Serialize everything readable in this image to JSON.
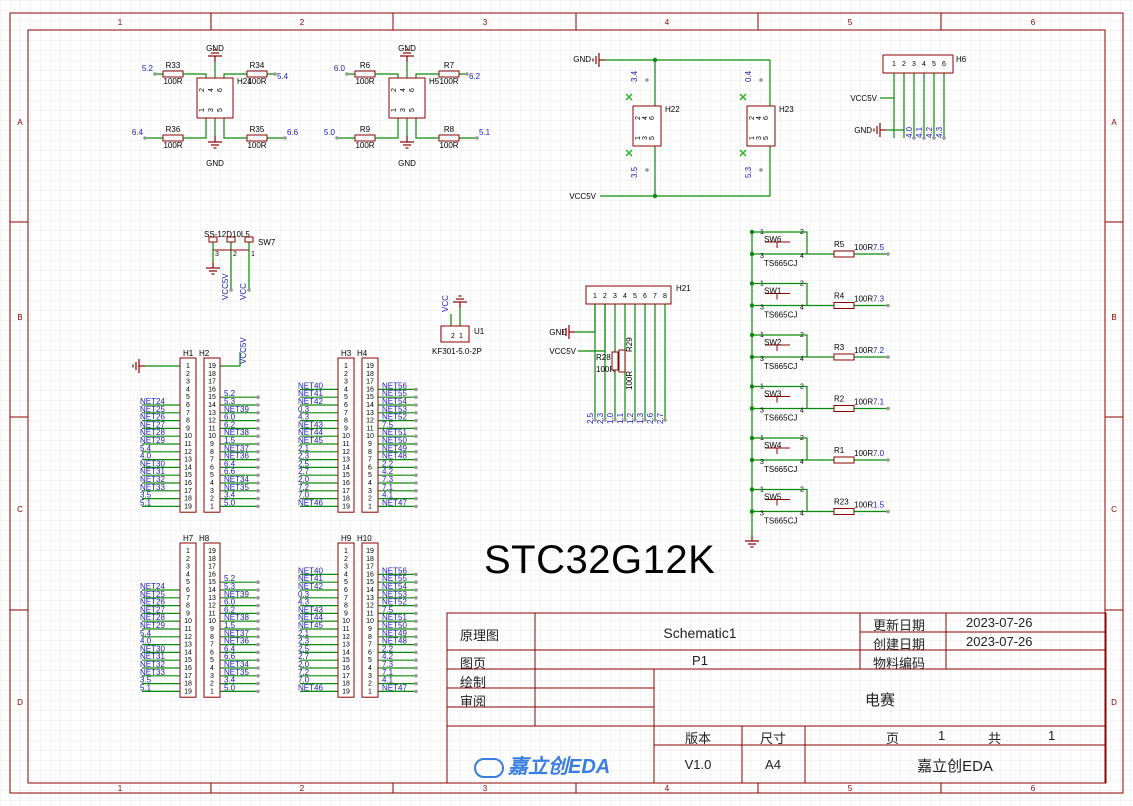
{
  "title": "STC32G12K",
  "border": {
    "columns": [
      "1",
      "2",
      "3",
      "4",
      "5",
      "6"
    ],
    "rows": [
      "A",
      "B",
      "C",
      "D"
    ]
  },
  "title_block": {
    "schematic_label": "原理图",
    "schematic_value": "Schematic1",
    "page_label": "图页",
    "page_value": "P1",
    "drawn_label": "绘制",
    "review_label": "审阅",
    "updated_label": "更新日期",
    "updated_value": "2023-07-26",
    "created_label": "创建日期",
    "created_value": "2023-07-26",
    "material_label": "物料编码",
    "project_name": "电赛",
    "version_label": "版本",
    "version_value": "V1.0",
    "size_label": "尺寸",
    "size_value": "A4",
    "pages_label": "页",
    "page_num": "1",
    "total_label": "共",
    "total_num": "1",
    "company": "嘉立创EDA",
    "logo": "嘉立创EDA"
  },
  "components": {
    "h24": {
      "ref": "H24",
      "r_tl": "R33",
      "r_tr": "R34",
      "r_bl": "R36",
      "r_br": "R35",
      "val": "100R",
      "n_tl": "5.2",
      "n_tr": "5.4",
      "n_bl": "6.4",
      "n_br": "6.6"
    },
    "h5": {
      "ref": "H5",
      "r_tl": "R6",
      "r_tr": "R7",
      "r_bl": "R9",
      "r_br": "R8",
      "val": "100R",
      "n_tl": "6.0",
      "n_tr": "6.2",
      "n_bl": "5.0",
      "n_br": "5.1"
    },
    "gnd": "GND",
    "vcc5v": "VCC5V",
    "vcc": "VCC",
    "h22": {
      "ref": "H22",
      "n_top": "3.4",
      "n_bot": "3.5"
    },
    "h23": {
      "ref": "H23",
      "n_top": "0.4",
      "n_bot": "5.3"
    },
    "h6": {
      "ref": "H6",
      "pins": [
        "1",
        "2",
        "3",
        "4",
        "5",
        "6"
      ],
      "nets": [
        "4.0",
        "4.1",
        "4.2",
        "4.3"
      ]
    },
    "sw7": {
      "ref": "SW7",
      "part": "SS-12D10L5",
      "pins": [
        "3",
        "2",
        "1"
      ]
    },
    "u1": {
      "ref": "U1",
      "part": "KF301-5.0-2P",
      "pins": [
        "2",
        "1"
      ]
    },
    "h21": {
      "ref": "H21",
      "pins": [
        "1",
        "2",
        "3",
        "4",
        "5",
        "6",
        "7",
        "8"
      ],
      "nets": [
        "2.5",
        "2.3",
        "1.0",
        "1.1",
        "1.2",
        "1.3",
        "2.6",
        "2.7"
      ],
      "r_ref": "R28",
      "r_val": "100R",
      "r2_ref": "R29",
      "r2_val": "100R"
    },
    "switches": [
      {
        "ref": "SW6",
        "part": "TS665CJ",
        "r": "R5",
        "val": "100R",
        "net": "7.5"
      },
      {
        "ref": "SW1",
        "part": "TS665CJ",
        "r": "R4",
        "val": "100R",
        "net": "7.3"
      },
      {
        "ref": "SW2",
        "part": "TS665CJ",
        "r": "R3",
        "val": "100R",
        "net": "7.2"
      },
      {
        "ref": "SW3",
        "part": "TS665CJ",
        "r": "R2",
        "val": "100R",
        "net": "7.1"
      },
      {
        "ref": "SW4",
        "part": "TS665CJ",
        "r": "R1",
        "val": "100R",
        "net": "7.0"
      },
      {
        "ref": "SW5",
        "part": "TS665CJ",
        "r": "R23",
        "val": "100R",
        "net": "1.5"
      }
    ],
    "header_pairs": [
      {
        "a": "H1",
        "b": "H2",
        "left": [
          "NET24",
          "NET25",
          "NET26",
          "NET27",
          "NET28",
          "NET29",
          "5.4",
          "4.0",
          "NET30",
          "NET31",
          "NET32",
          "NET33",
          "3.5",
          "5.1"
        ],
        "right": [
          "5.2",
          "5.3",
          "NET39",
          "6.0",
          "6.2",
          "NET38",
          "1.5",
          "NET37",
          "NET36",
          "6.4",
          "6.6",
          "NET34",
          "NET35",
          "3.4",
          "5.0"
        ]
      },
      {
        "a": "H3",
        "b": "H4",
        "left": [
          "NET40",
          "NET41",
          "NET42",
          "0.3",
          "4.3",
          "NET43",
          "NET44",
          "NET45",
          "2.1",
          "2.3",
          "2.5",
          "2.7",
          "2.0",
          "7.2",
          "7.0",
          "NET46"
        ],
        "right": [
          "NET56",
          "NET55",
          "NET54",
          "NET53",
          "NET52",
          "7.5",
          "NET51",
          "NET50",
          "NET49",
          "NET48",
          "2.2",
          "4.2",
          "7.3",
          "7.1",
          "4.1",
          "NET47"
        ]
      },
      {
        "a": "H7",
        "b": "H8",
        "left": [
          "NET24",
          "NET25",
          "NET26",
          "NET27",
          "NET28",
          "NET29",
          "5.4",
          "4.0",
          "NET30",
          "NET31",
          "NET32",
          "NET33",
          "3.5",
          "5.1"
        ],
        "right": [
          "5.2",
          "5.3",
          "NET39",
          "6.0",
          "6.2",
          "NET38",
          "1.5",
          "NET37",
          "NET36",
          "6.4",
          "6.6",
          "NET34",
          "NET35",
          "3.4",
          "5.0"
        ]
      },
      {
        "a": "H9",
        "b": "H10",
        "left": [
          "NET40",
          "NET41",
          "NET42",
          "0.3",
          "4.3",
          "NET43",
          "NET44",
          "NET45",
          "2.1",
          "2.3",
          "2.5",
          "2.7",
          "2.0",
          "7.2",
          "7.0",
          "NET46"
        ],
        "right": [
          "NET56",
          "NET55",
          "NET54",
          "NET53",
          "NET52",
          "7.5",
          "NET51",
          "NET50",
          "NET49",
          "NET48",
          "2.2",
          "4.2",
          "7.3",
          "7.1",
          "4.1",
          "NET47"
        ]
      }
    ]
  },
  "colors": {
    "border": "#8b0000",
    "wire": "#0a8a0a",
    "component": "#8b0000",
    "net_label": "#1a1ab8",
    "grid": "#e6e6e6"
  }
}
